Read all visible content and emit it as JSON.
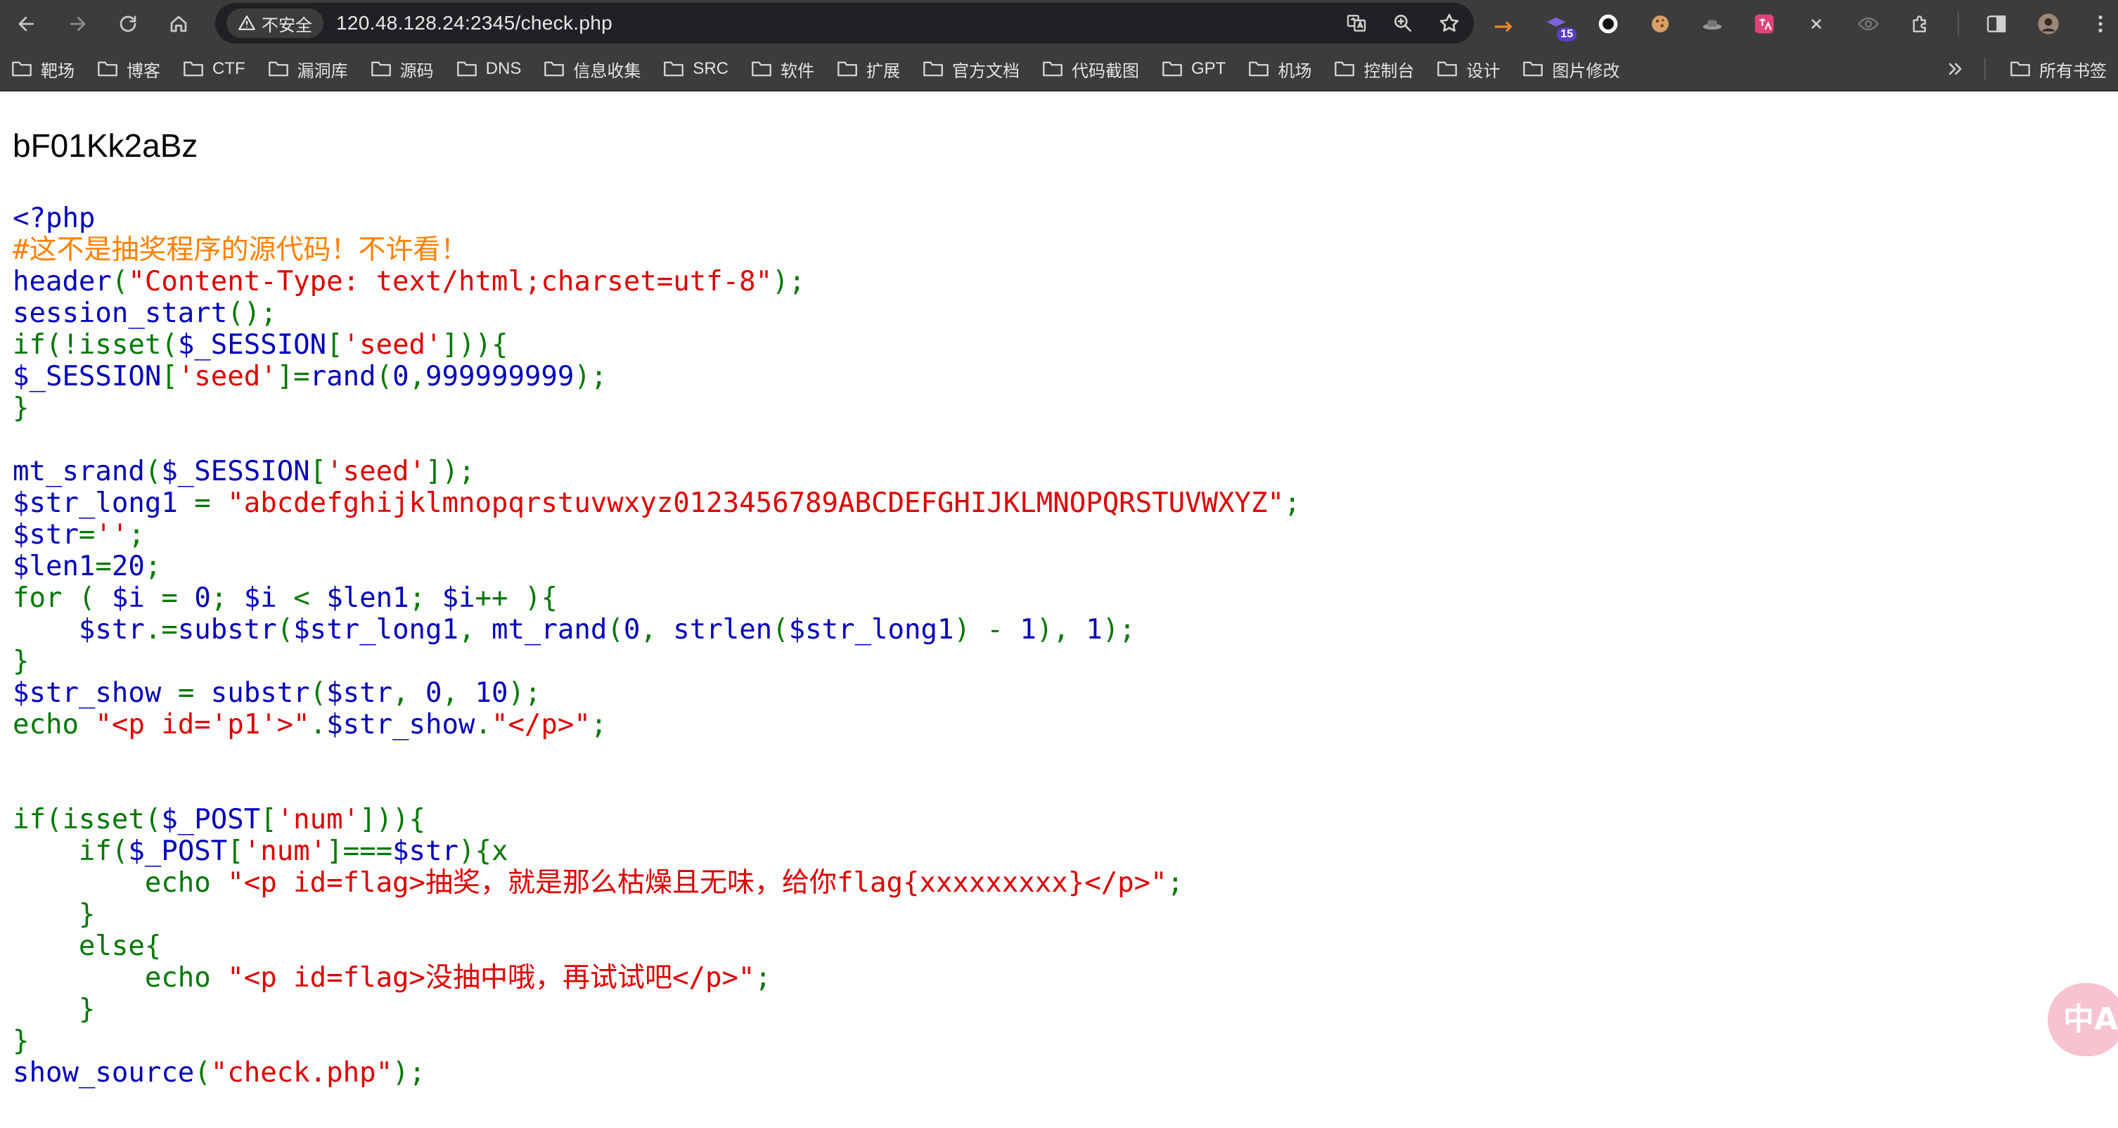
{
  "browser": {
    "security_label": "不安全",
    "url": "120.48.128.24:2345/check.php",
    "extension_badge": "15",
    "icons": [
      "back-icon",
      "forward-icon",
      "reload-icon",
      "home-icon",
      "translate-icon",
      "zoom-icon",
      "bookmark-star-icon",
      "extensions-icon",
      "sidepanel-icon",
      "profile-avatar",
      "menu-icon"
    ]
  },
  "bookmarks": {
    "items": [
      "靶场",
      "博客",
      "CTF",
      "漏洞库",
      "源码",
      "DNS",
      "信息收集",
      "SRC",
      "软件",
      "扩展",
      "官方文档",
      "代码截图",
      "GPT",
      "机场",
      "控制台",
      "设计",
      "图片修改"
    ],
    "all_bookmarks": "所有书签"
  },
  "page": {
    "random_output": "bF01Kk2aBz",
    "floating_button_label": "中A",
    "source_lines": [
      [
        [
          "d",
          "<?php"
        ]
      ],
      [
        [
          "c",
          "#这不是抽奖程序的源代码！不许看！"
        ]
      ],
      [
        [
          "d",
          "header"
        ],
        [
          "k",
          "("
        ],
        [
          "s",
          "\"Content-Type: text/html;charset=utf-8\""
        ],
        [
          "k",
          ");"
        ]
      ],
      [
        [
          "d",
          "session_start"
        ],
        [
          "k",
          "();"
        ]
      ],
      [
        [
          "k",
          "if(!isset("
        ],
        [
          "d",
          "$_SESSION"
        ],
        [
          "k",
          "["
        ],
        [
          "s",
          "'seed'"
        ],
        [
          "k",
          "])){"
        ]
      ],
      [
        [
          "d",
          "$_SESSION"
        ],
        [
          "k",
          "["
        ],
        [
          "s",
          "'seed'"
        ],
        [
          "k",
          "]="
        ],
        [
          "d",
          "rand"
        ],
        [
          "k",
          "("
        ],
        [
          "d",
          "0"
        ],
        [
          "k",
          ","
        ],
        [
          "d",
          "999999999"
        ],
        [
          "k",
          ");"
        ]
      ],
      [
        [
          "k",
          "}"
        ]
      ],
      [],
      [
        [
          "d",
          "mt_srand"
        ],
        [
          "k",
          "("
        ],
        [
          "d",
          "$_SESSION"
        ],
        [
          "k",
          "["
        ],
        [
          "s",
          "'seed'"
        ],
        [
          "k",
          "]);"
        ]
      ],
      [
        [
          "d",
          "$str_long1 "
        ],
        [
          "k",
          "= "
        ],
        [
          "s",
          "\"abcdefghijklmnopqrstuvwxyz0123456789ABCDEFGHIJKLMNOPQRSTUVWXYZ\""
        ],
        [
          "k",
          ";"
        ]
      ],
      [
        [
          "d",
          "$str"
        ],
        [
          "k",
          "="
        ],
        [
          "s",
          "''"
        ],
        [
          "k",
          ";"
        ]
      ],
      [
        [
          "d",
          "$len1"
        ],
        [
          "k",
          "="
        ],
        [
          "d",
          "20"
        ],
        [
          "k",
          ";"
        ]
      ],
      [
        [
          "k",
          "for ( "
        ],
        [
          "d",
          "$i "
        ],
        [
          "k",
          "= "
        ],
        [
          "d",
          "0"
        ],
        [
          "k",
          "; "
        ],
        [
          "d",
          "$i "
        ],
        [
          "k",
          "< "
        ],
        [
          "d",
          "$len1"
        ],
        [
          "k",
          "; "
        ],
        [
          "d",
          "$i"
        ],
        [
          "k",
          "++ ){"
        ]
      ],
      [
        [
          "k",
          "    "
        ],
        [
          "d",
          "$str"
        ],
        [
          "k",
          ".="
        ],
        [
          "d",
          "substr"
        ],
        [
          "k",
          "("
        ],
        [
          "d",
          "$str_long1"
        ],
        [
          "k",
          ", "
        ],
        [
          "d",
          "mt_rand"
        ],
        [
          "k",
          "("
        ],
        [
          "d",
          "0"
        ],
        [
          "k",
          ", "
        ],
        [
          "d",
          "strlen"
        ],
        [
          "k",
          "("
        ],
        [
          "d",
          "$str_long1"
        ],
        [
          "k",
          ") - "
        ],
        [
          "d",
          "1"
        ],
        [
          "k",
          "), "
        ],
        [
          "d",
          "1"
        ],
        [
          "k",
          ");"
        ]
      ],
      [
        [
          "k",
          "}"
        ]
      ],
      [
        [
          "d",
          "$str_show "
        ],
        [
          "k",
          "= "
        ],
        [
          "d",
          "substr"
        ],
        [
          "k",
          "("
        ],
        [
          "d",
          "$str"
        ],
        [
          "k",
          ", "
        ],
        [
          "d",
          "0"
        ],
        [
          "k",
          ", "
        ],
        [
          "d",
          "10"
        ],
        [
          "k",
          ");"
        ]
      ],
      [
        [
          "k",
          "echo "
        ],
        [
          "s",
          "\"<p id='p1'>\""
        ],
        [
          "k",
          "."
        ],
        [
          "d",
          "$str_show"
        ],
        [
          "k",
          "."
        ],
        [
          "s",
          "\"</p>\""
        ],
        [
          "k",
          ";"
        ]
      ],
      [],
      [],
      [
        [
          "k",
          "if(isset("
        ],
        [
          "d",
          "$_POST"
        ],
        [
          "k",
          "["
        ],
        [
          "s",
          "'num'"
        ],
        [
          "k",
          "])){"
        ]
      ],
      [
        [
          "k",
          "    if("
        ],
        [
          "d",
          "$_POST"
        ],
        [
          "k",
          "["
        ],
        [
          "s",
          "'num'"
        ],
        [
          "k",
          "]==="
        ],
        [
          "d",
          "$str"
        ],
        [
          "k",
          "){x"
        ]
      ],
      [
        [
          "k",
          "        echo "
        ],
        [
          "s",
          "\"<p id=flag>抽奖，就是那么枯燥且无味，给你flag{xxxxxxxxx}</p>\""
        ],
        [
          "k",
          ";"
        ]
      ],
      [
        [
          "k",
          "    }"
        ]
      ],
      [
        [
          "k",
          "    else{"
        ]
      ],
      [
        [
          "k",
          "        echo "
        ],
        [
          "s",
          "\"<p id=flag>没抽中哦，再试试吧</p>\""
        ],
        [
          "k",
          ";"
        ]
      ],
      [
        [
          "k",
          "    }"
        ]
      ],
      [
        [
          "k",
          "}"
        ]
      ],
      [
        [
          "d",
          "show_source"
        ],
        [
          "k",
          "("
        ],
        [
          "s",
          "\"check.php\""
        ],
        [
          "k",
          ");"
        ]
      ]
    ]
  }
}
